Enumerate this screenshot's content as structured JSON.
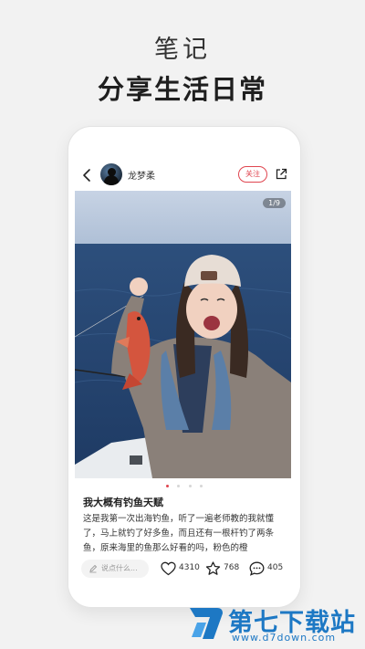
{
  "promo": {
    "subtitle": "笔记",
    "headline": "分享生活日常"
  },
  "note": {
    "author": "龙梦柔",
    "follow_label": "关注",
    "image_counter": "1/9",
    "carousel": {
      "total_dots": 4,
      "active_index": 0
    },
    "title": "我大概有钓鱼天赋",
    "body": "这是我第一次出海钓鱼，听了一遍老师教的我就懂了，马上就钓了好多鱼，而且还有一根杆钓了两条鱼，原来海里的鱼那么好看的吗，粉色的橙"
  },
  "actions": {
    "comment_placeholder": "说点什么...",
    "likes": "4310",
    "favorites": "768",
    "comments": "405"
  },
  "icons": {
    "back": "chevron-left-icon",
    "share": "share-icon",
    "pen": "pen-icon",
    "like": "heart-icon",
    "favorite": "star-icon",
    "comment": "comment-icon"
  },
  "watermark": {
    "name": "第七下载站",
    "url": "www.d7down.com"
  },
  "colors": {
    "accent": "#e0454f",
    "watermark_blue": "#1d78c4",
    "background": "#f2f2f2"
  }
}
